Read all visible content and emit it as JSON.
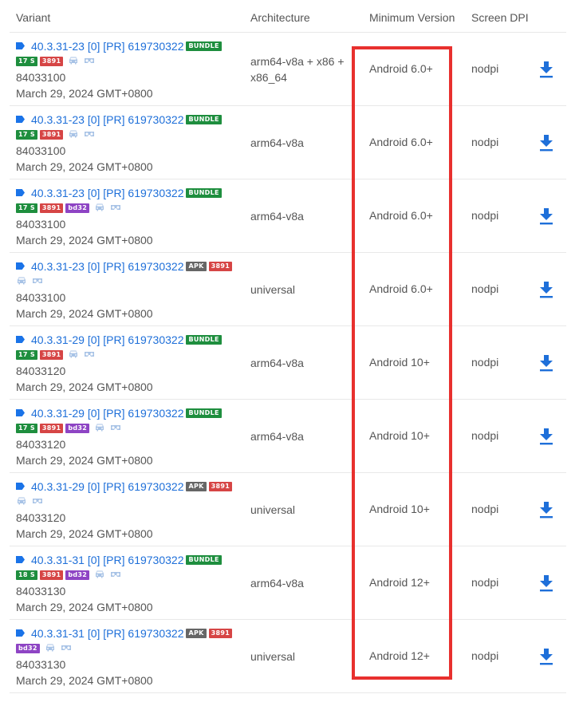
{
  "headers": {
    "variant": "Variant",
    "architecture": "Architecture",
    "min_version": "Minimum Version",
    "screen_dpi": "Screen DPI"
  },
  "colors": {
    "link": "#1e6fd9",
    "highlight": "#e8302e",
    "badge_bundle": "#1e8e3e",
    "badge_api": "#1e8e3e",
    "badge_3891": "#d64545",
    "badge_bd32": "#8e44c4",
    "badge_apk": "#666666",
    "icon_light": "#a8c3e6"
  },
  "rows": [
    {
      "variant": "40.3.31-23 [0] [PR] 619730322",
      "type_badge": "BUNDLE",
      "badges": [
        "17 S",
        "3891"
      ],
      "icons": [
        "car-icon",
        "vr-icon"
      ],
      "code": "84033100",
      "date": "March 29, 2024 GMT+0800",
      "arch": "arm64-v8a + x86 + x86_64",
      "min_version": "Android 6.0+",
      "dpi": "nodpi"
    },
    {
      "variant": "40.3.31-23 [0] [PR] 619730322",
      "type_badge": "BUNDLE",
      "badges": [
        "17 S",
        "3891"
      ],
      "icons": [
        "car-icon",
        "vr-icon"
      ],
      "code": "84033100",
      "date": "March 29, 2024 GMT+0800",
      "arch": "arm64-v8a",
      "min_version": "Android 6.0+",
      "dpi": "nodpi"
    },
    {
      "variant": "40.3.31-23 [0] [PR] 619730322",
      "type_badge": "BUNDLE",
      "badges": [
        "17 S",
        "3891",
        "bd32"
      ],
      "icons": [
        "car-icon",
        "vr-icon"
      ],
      "code": "84033100",
      "date": "March 29, 2024 GMT+0800",
      "arch": "arm64-v8a",
      "min_version": "Android 6.0+",
      "dpi": "nodpi"
    },
    {
      "variant": "40.3.31-23 [0] [PR] 619730322",
      "type_badge": "APK",
      "title_badges": [
        "3891"
      ],
      "badges": [],
      "icons": [
        "car-icon",
        "vr-icon"
      ],
      "code": "84033100",
      "date": "March 29, 2024 GMT+0800",
      "arch": "universal",
      "min_version": "Android 6.0+",
      "dpi": "nodpi"
    },
    {
      "variant": "40.3.31-29 [0] [PR] 619730322",
      "type_badge": "BUNDLE",
      "badges": [
        "17 S",
        "3891"
      ],
      "icons": [
        "car-icon",
        "vr-icon"
      ],
      "code": "84033120",
      "date": "March 29, 2024 GMT+0800",
      "arch": "arm64-v8a",
      "min_version": "Android 10+",
      "dpi": "nodpi"
    },
    {
      "variant": "40.3.31-29 [0] [PR] 619730322",
      "type_badge": "BUNDLE",
      "badges": [
        "17 S",
        "3891",
        "bd32"
      ],
      "icons": [
        "car-icon",
        "vr-icon"
      ],
      "code": "84033120",
      "date": "March 29, 2024 GMT+0800",
      "arch": "arm64-v8a",
      "min_version": "Android 10+",
      "dpi": "nodpi"
    },
    {
      "variant": "40.3.31-29 [0] [PR] 619730322",
      "type_badge": "APK",
      "title_badges": [
        "3891"
      ],
      "badges": [],
      "icons": [
        "car-icon",
        "vr-icon"
      ],
      "code": "84033120",
      "date": "March 29, 2024 GMT+0800",
      "arch": "universal",
      "min_version": "Android 10+",
      "dpi": "nodpi"
    },
    {
      "variant": "40.3.31-31 [0] [PR] 619730322",
      "type_badge": "BUNDLE",
      "badges": [
        "18 S",
        "3891",
        "bd32"
      ],
      "icons": [
        "car-icon",
        "vr-icon"
      ],
      "code": "84033130",
      "date": "March 29, 2024 GMT+0800",
      "arch": "arm64-v8a",
      "min_version": "Android 12+",
      "dpi": "nodpi"
    },
    {
      "variant": "40.3.31-31 [0] [PR] 619730322",
      "type_badge": "APK",
      "title_badges": [
        "3891"
      ],
      "badges": [
        "bd32"
      ],
      "icons": [
        "car-icon",
        "vr-icon"
      ],
      "code": "84033130",
      "date": "March 29, 2024 GMT+0800",
      "arch": "universal",
      "min_version": "Android 12+",
      "dpi": "nodpi"
    }
  ]
}
